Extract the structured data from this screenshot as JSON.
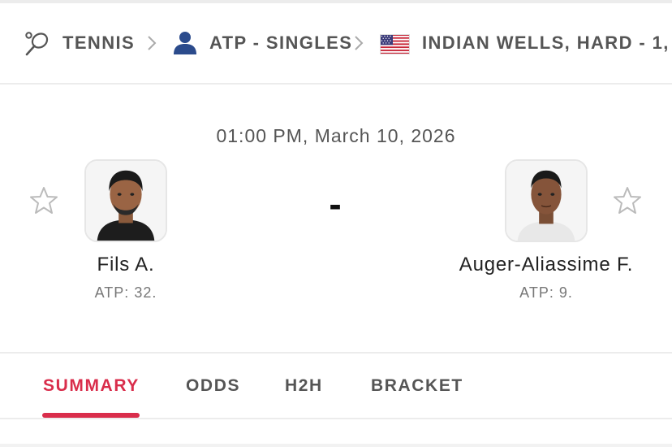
{
  "breadcrumb": {
    "sport": "TENNIS",
    "category": "ATP - SINGLES",
    "tournament": "INDIAN WELLS, HARD - 1,",
    "sport_icon": "tennis-racket-icon",
    "category_icon": "person-icon",
    "tournament_icon": "usa-flag-icon"
  },
  "match": {
    "datetime": "01:00 PM, March 10, 2026",
    "score": "-",
    "home": {
      "name": "Fils A.",
      "rank": "ATP: 32."
    },
    "away": {
      "name": "Auger-Aliassime F.",
      "rank": "ATP: 9."
    }
  },
  "tabs": [
    {
      "label": "SUMMARY",
      "active": true
    },
    {
      "label": "ODDS",
      "active": false
    },
    {
      "label": "H2H",
      "active": false
    },
    {
      "label": "BRACKET",
      "active": false
    }
  ],
  "colors": {
    "accent": "#d92d4b",
    "text": "#555555",
    "divider": "#ececec",
    "icon_blue": "#2b4b8c"
  }
}
